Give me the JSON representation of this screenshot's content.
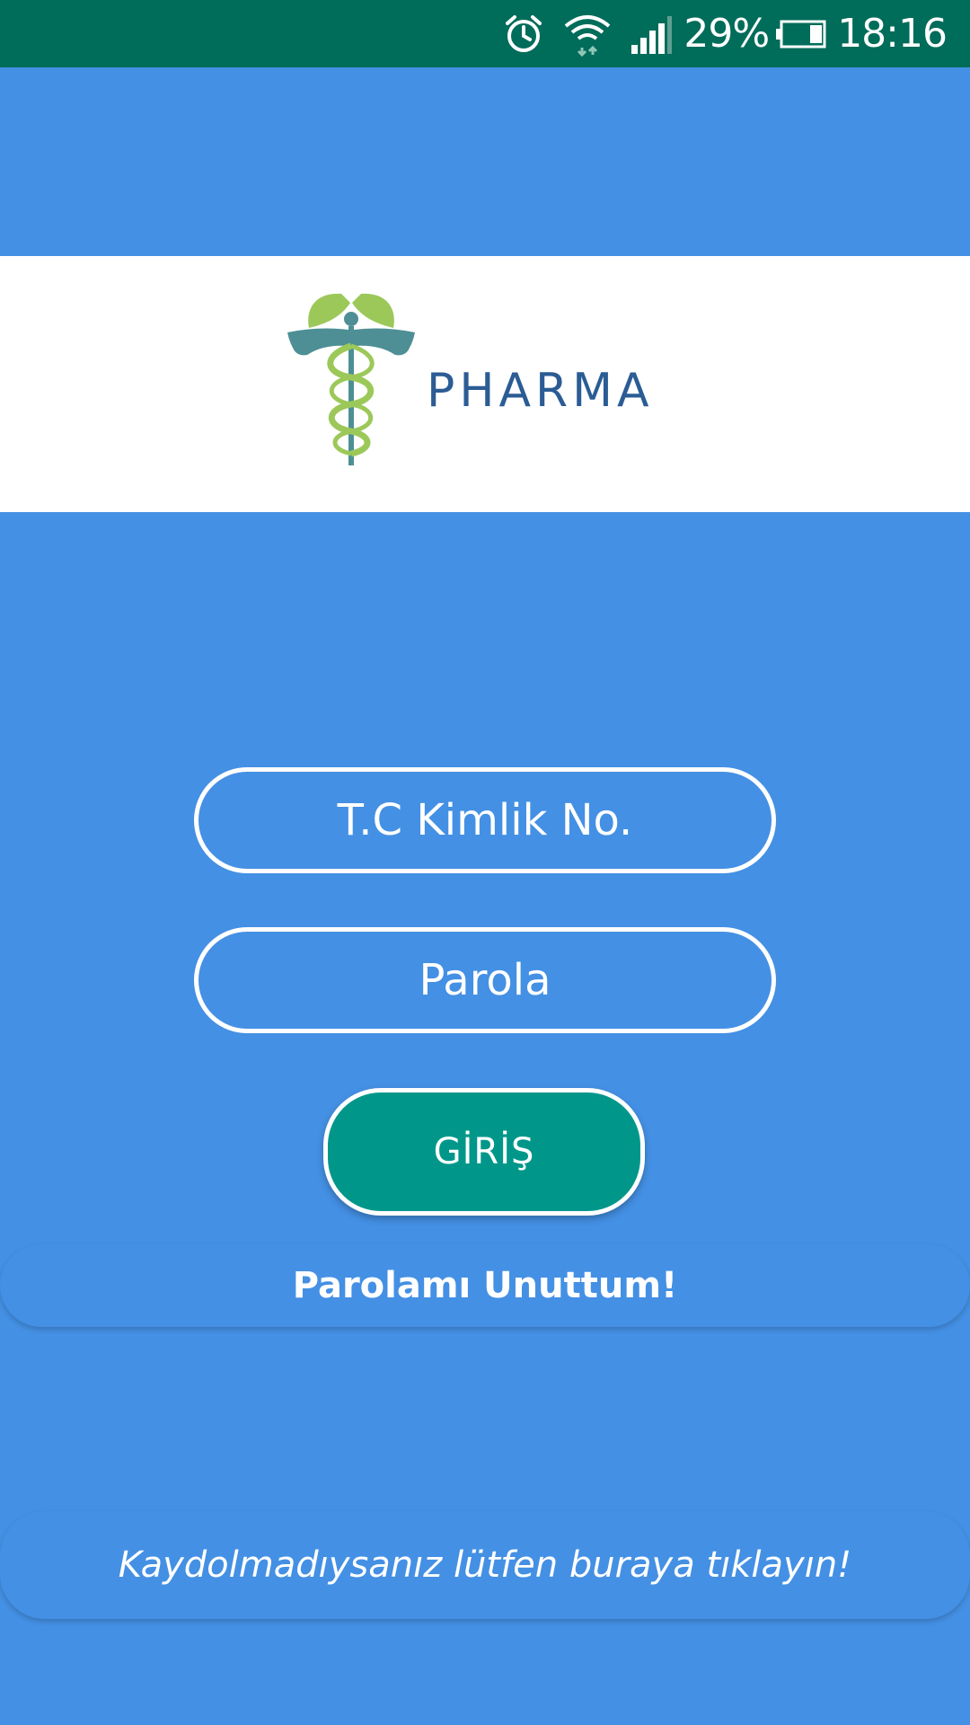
{
  "status_bar": {
    "battery_percent": "29%",
    "time": "18:16",
    "icons": [
      "alarm-icon",
      "wifi-icon",
      "signal-icon",
      "battery-icon"
    ]
  },
  "brand": {
    "name": "PHARMA",
    "logo_icon": "caduceus-icon",
    "brand_color": "#2b5c94"
  },
  "form": {
    "id_placeholder": "T.C Kimlik No.",
    "password_placeholder": "Parola",
    "login_label": "GİRİŞ"
  },
  "links": {
    "forgot_password": "Parolamı Unuttum!",
    "register": "Kaydolmadıysanız lütfen buraya tıklayın!"
  },
  "colors": {
    "background": "#4490e4",
    "status_bar": "#006c5a",
    "login_button": "#00978a",
    "logo_band": "#ffffff"
  }
}
